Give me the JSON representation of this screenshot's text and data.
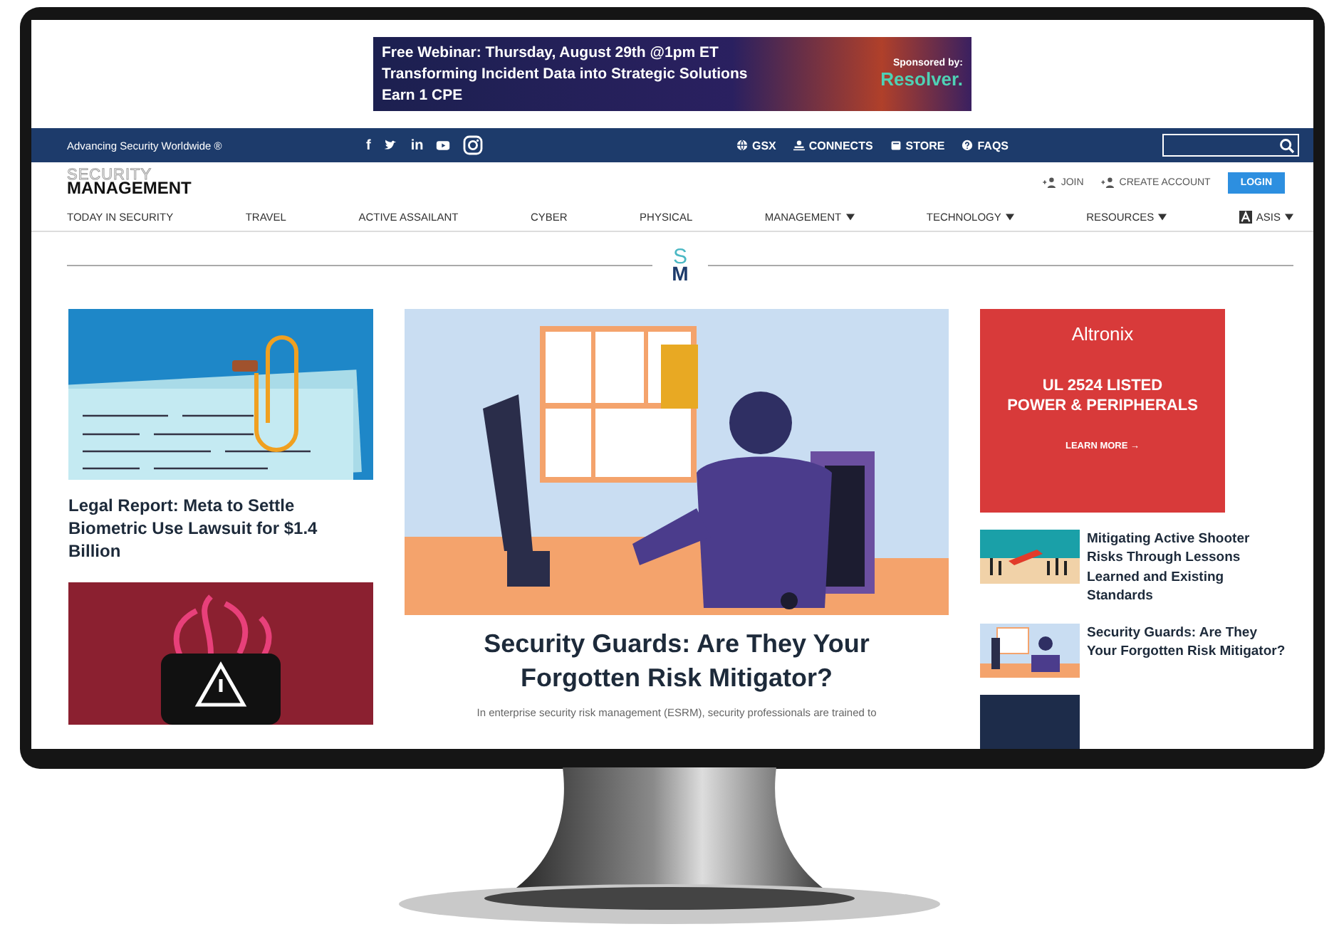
{
  "banner_ad": {
    "lines": [
      "Free Webinar: Thursday, August 29th @1pm ET",
      "Transforming Incident Data into Strategic Solutions",
      "Earn 1 CPE"
    ],
    "sponsor_label": "Sponsored by:",
    "sponsor": "Resolver."
  },
  "top_bar": {
    "tagline": "Advancing Security Worldwide ®",
    "social": [
      {
        "kind": "letter",
        "text": "f"
      },
      {
        "kind": "bird"
      },
      {
        "kind": "letter",
        "text": "in"
      },
      {
        "kind": "play"
      },
      {
        "kind": "camera"
      }
    ],
    "links": [
      {
        "kind": "globe",
        "label": "GSX"
      },
      {
        "kind": "people",
        "label": "CONNECTS"
      },
      {
        "kind": "cart",
        "label": "STORE"
      },
      {
        "kind": "help",
        "label": "FAQS"
      }
    ]
  },
  "header": {
    "logo_top": "SECURITY",
    "logo_bottom": "MANAGEMENT",
    "join": "JOIN",
    "create_account": "CREATE ACCOUNT",
    "login": "LOGIN"
  },
  "nav": [
    {
      "label": "TODAY IN SECURITY",
      "dropdown": false,
      "badge": false
    },
    {
      "label": "TRAVEL",
      "dropdown": false,
      "badge": false
    },
    {
      "label": "ACTIVE ASSAILANT",
      "dropdown": false,
      "badge": false
    },
    {
      "label": "CYBER",
      "dropdown": false,
      "badge": false
    },
    {
      "label": "PHYSICAL",
      "dropdown": false,
      "badge": false
    },
    {
      "label": "MANAGEMENT",
      "dropdown": true,
      "badge": false
    },
    {
      "label": "TECHNOLOGY",
      "dropdown": true,
      "badge": false
    },
    {
      "label": "RESOURCES",
      "dropdown": true,
      "badge": false
    },
    {
      "label": "ASIS",
      "dropdown": true,
      "badge": true
    }
  ],
  "section_logo": {
    "top": "S",
    "bottom": "M"
  },
  "left_articles": [
    {
      "kind": "documents",
      "title": "Legal Report: Meta to Settle Biometric Use Lawsuit for $1.4 Billion"
    },
    {
      "kind": "warning"
    }
  ],
  "featured": {
    "title": "Security Guards: Are They Your Forgotten Risk Mitigator?",
    "excerpt": "In enterprise security risk management (ESRM), security professionals are trained to"
  },
  "side_ad": {
    "brand": "Altronix",
    "lines": [
      "UL 2524 LISTED",
      "POWER & PERIPHERALS"
    ],
    "cta": "LEARN MORE →"
  },
  "side_stories": [
    {
      "kind": "crowd",
      "title": "Mitigating Active Shooter Risks Through Lessons Learned and Existing Standards"
    },
    {
      "kind": "guard",
      "title": "Security Guards: Are They Your Forgotten Risk Mitigator?"
    },
    {
      "kind": "dark"
    }
  ]
}
